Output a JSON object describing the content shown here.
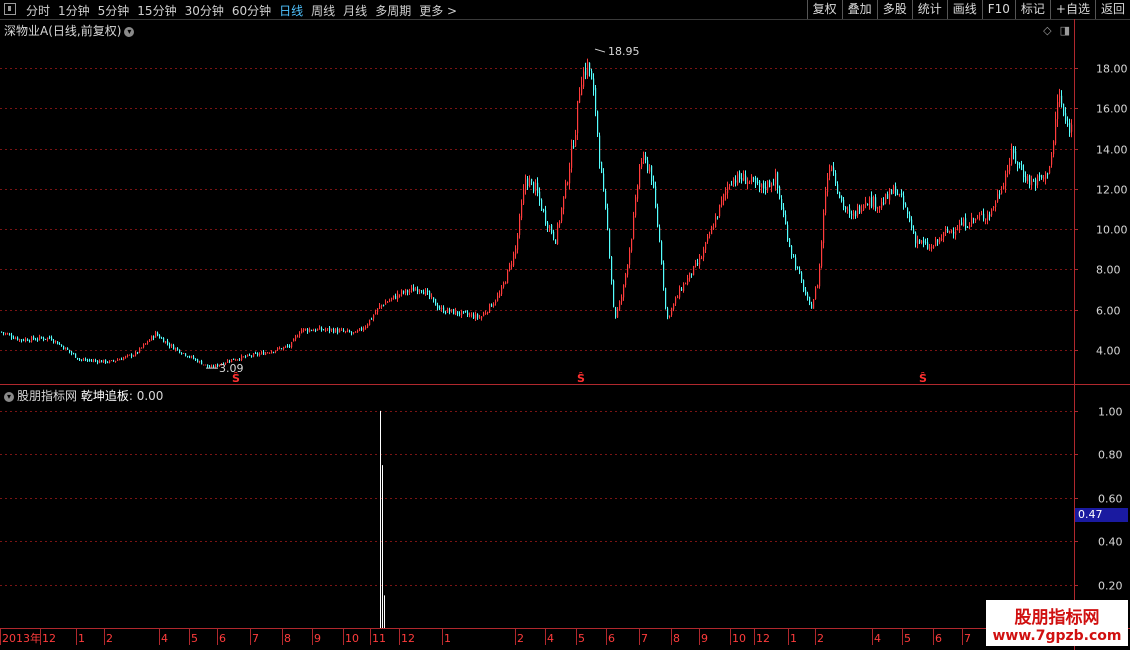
{
  "toolbar": {
    "periods": [
      "分时",
      "1分钟",
      "5分钟",
      "15分钟",
      "30分钟",
      "60分钟",
      "日线",
      "周线",
      "月线",
      "多周期",
      "更多 >"
    ],
    "active_period": "日线",
    "tools": [
      "复权",
      "叠加",
      "多股",
      "统计",
      "画线",
      "F10",
      "标记",
      "+自选",
      "返回"
    ]
  },
  "main_panel": {
    "title": "深物业A(日线,前复权)",
    "high_label": "18.95",
    "low_label": "3.09",
    "signal_marker": "Ŝ"
  },
  "indicator_panel": {
    "title": "股朋指标网",
    "indicator_name": "乾坤追板",
    "indicator_value": "0.00",
    "current_value_tag": "0.47"
  },
  "watermark": {
    "line1": "股朋指标网",
    "line2": "www.7gpzb.com"
  },
  "colors": {
    "up": "#ff3c3c",
    "down": "#54ffff",
    "grid": "#7a1414",
    "axis": "#b0282d",
    "active": "#4fc3ff"
  },
  "chart_data": [
    {
      "type": "candlestick",
      "y_ticks": [
        4.0,
        6.0,
        8.0,
        10.0,
        12.0,
        14.0,
        16.0,
        18.0
      ],
      "ylim": [
        2.3,
        19.5
      ],
      "x_month_labels": [
        "2013年",
        "12",
        "1",
        "2",
        "4",
        "5",
        "6",
        "7",
        "8",
        "9",
        "10",
        "11",
        "12",
        "1",
        "2",
        "4",
        "5",
        "6",
        "7",
        "8",
        "9",
        "10",
        "12",
        "1",
        "2",
        "4",
        "5",
        "6",
        "7"
      ],
      "close_trend": [
        [
          0,
          4.9
        ],
        [
          20,
          4.5
        ],
        [
          50,
          4.6
        ],
        [
          80,
          3.5
        ],
        [
          110,
          3.4
        ],
        [
          135,
          3.8
        ],
        [
          155,
          4.8
        ],
        [
          170,
          4.2
        ],
        [
          195,
          3.5
        ],
        [
          210,
          3.1
        ],
        [
          230,
          3.5
        ],
        [
          260,
          3.8
        ],
        [
          290,
          4.2
        ],
        [
          300,
          5.0
        ],
        [
          330,
          5.0
        ],
        [
          355,
          4.8
        ],
        [
          365,
          5.2
        ],
        [
          380,
          6.2
        ],
        [
          400,
          6.8
        ],
        [
          420,
          7.1
        ],
        [
          440,
          6.0
        ],
        [
          460,
          5.8
        ],
        [
          480,
          5.6
        ],
        [
          500,
          6.8
        ],
        [
          515,
          9.0
        ],
        [
          525,
          12.5
        ],
        [
          535,
          12.0
        ],
        [
          545,
          10.5
        ],
        [
          555,
          9.5
        ],
        [
          565,
          12.0
        ],
        [
          575,
          15.0
        ],
        [
          580,
          17.5
        ],
        [
          588,
          18.2
        ],
        [
          595,
          16.0
        ],
        [
          600,
          13.0
        ],
        [
          608,
          9.5
        ],
        [
          614,
          5.5
        ],
        [
          622,
          6.8
        ],
        [
          632,
          10.0
        ],
        [
          640,
          13.5
        ],
        [
          650,
          13.0
        ],
        [
          660,
          9.0
        ],
        [
          666,
          5.5
        ],
        [
          680,
          7.0
        ],
        [
          700,
          8.5
        ],
        [
          715,
          10.5
        ],
        [
          730,
          12.5
        ],
        [
          745,
          12.5
        ],
        [
          760,
          12.0
        ],
        [
          775,
          12.5
        ],
        [
          790,
          9.0
        ],
        [
          800,
          7.5
        ],
        [
          810,
          6.0
        ],
        [
          818,
          7.5
        ],
        [
          825,
          12.0
        ],
        [
          830,
          13.5
        ],
        [
          840,
          11.5
        ],
        [
          850,
          10.5
        ],
        [
          865,
          11.5
        ],
        [
          880,
          11.2
        ],
        [
          895,
          12.0
        ],
        [
          905,
          11.0
        ],
        [
          915,
          9.5
        ],
        [
          930,
          9.0
        ],
        [
          945,
          9.8
        ],
        [
          960,
          10.2
        ],
        [
          975,
          10.5
        ],
        [
          990,
          10.8
        ],
        [
          1000,
          12.0
        ],
        [
          1012,
          13.8
        ],
        [
          1020,
          13.0
        ],
        [
          1030,
          12.3
        ],
        [
          1045,
          12.6
        ],
        [
          1052,
          13.8
        ],
        [
          1058,
          16.8
        ],
        [
          1065,
          15.2
        ],
        [
          1072,
          15.0
        ]
      ]
    },
    {
      "type": "line",
      "y_ticks": [
        0.2,
        0.4,
        0.6,
        0.8,
        1.0
      ],
      "ylim": [
        0.0,
        1.05
      ],
      "spikes": [
        [
          380,
          1.0
        ],
        [
          382,
          0.75
        ],
        [
          384,
          0.15
        ]
      ]
    }
  ]
}
